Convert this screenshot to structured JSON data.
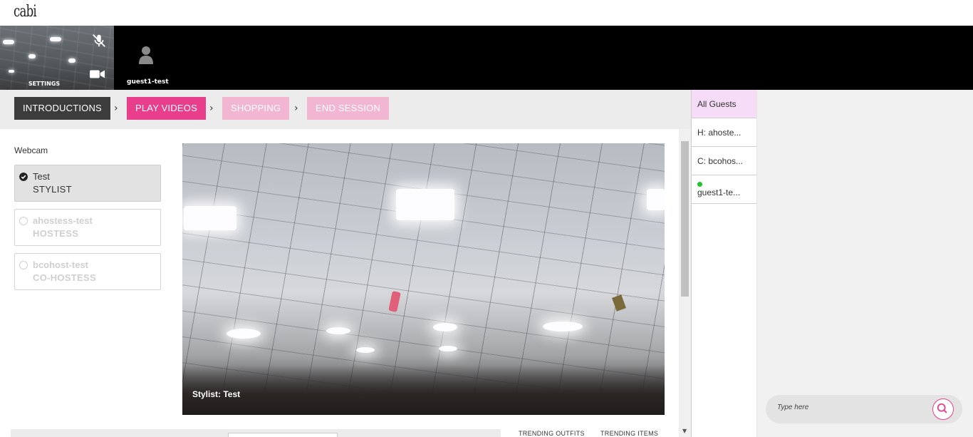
{
  "app": {
    "logo": "cabi"
  },
  "videobar": {
    "self_label": "SETTINGS",
    "guest_name": "guest1-test"
  },
  "steps": [
    {
      "label": "INTRODUCTIONS",
      "state": "active"
    },
    {
      "label": "PLAY VIDEOS",
      "state": "next"
    },
    {
      "label": "SHOPPING",
      "state": "disabled"
    },
    {
      "label": "END SESSION",
      "state": "disabled"
    }
  ],
  "webcam": {
    "label": "Webcam",
    "people": [
      {
        "name": "Test",
        "role": "STYLIST",
        "selected": true
      },
      {
        "name": "ahostess-test",
        "role": "HOSTESS",
        "selected": false
      },
      {
        "name": "bcohost-test",
        "role": "CO-HOSTESS",
        "selected": false
      }
    ],
    "stage_caption": "Stylist: Test"
  },
  "bottom": {
    "trending_outfits": "TRENDING OUTFITS",
    "trending_items": "TRENDING ITEMS"
  },
  "guests": {
    "all": "All Guests",
    "list": [
      "H: ahoste...",
      "C: bcohos...",
      "guest1-te..."
    ]
  },
  "chat": {
    "placeholder": "Type here"
  },
  "colors": {
    "accent": "#e83e8c",
    "accent_pale": "#f2b6d2",
    "online": "#22c42e"
  }
}
